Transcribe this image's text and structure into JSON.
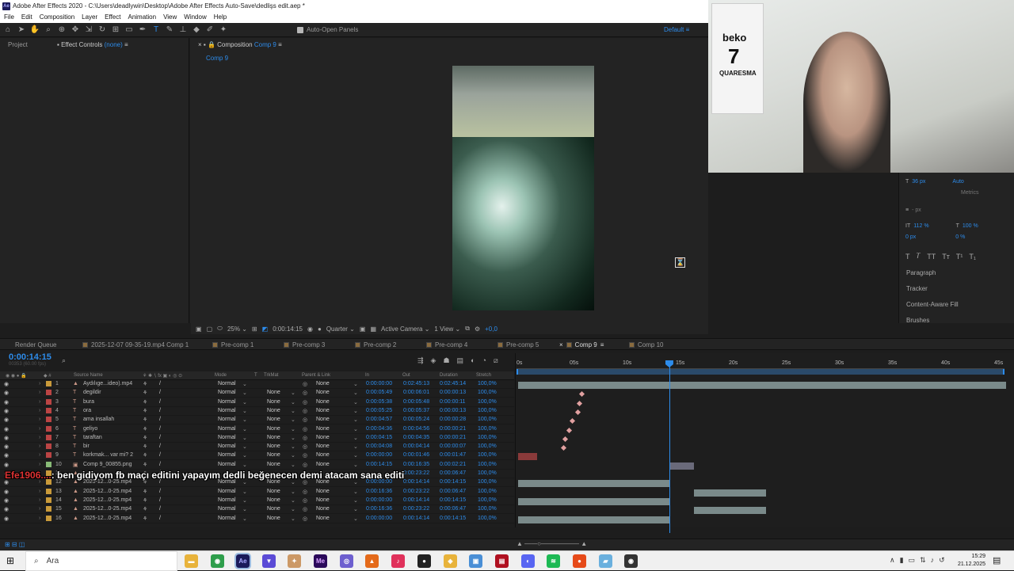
{
  "window": {
    "title": "Adobe After Effects 2020 - C:\\Users\\deadlywin\\Desktop\\Adobe After Effects Auto-Save\\dedlişs edit.aep *",
    "logo": "Ae"
  },
  "menu": [
    "File",
    "Edit",
    "Composition",
    "Layer",
    "Effect",
    "Animation",
    "View",
    "Window",
    "Help"
  ],
  "toolbar": {
    "auto_open": "Auto-Open Panels",
    "workspace": "Default"
  },
  "left_panel": {
    "tab_project": "Project",
    "tab_effect": "Effect Controls",
    "effect_target": "(none)"
  },
  "comp_panel": {
    "tab_label": "Composition",
    "tab_comp": "Comp 9",
    "breadcrumb": "Comp 9"
  },
  "viewer_footer": {
    "zoom": "25%",
    "time": "0:00:14:15",
    "resolution": "Quarter",
    "camera": "Active Camera",
    "view": "1 View",
    "exposure": "+0,0"
  },
  "webcam": {
    "shirt_brand": "beko",
    "shirt_number": "7",
    "shirt_name": "QUARESMA"
  },
  "character_panel": {
    "font_size": "36 px",
    "leading": "Auto",
    "kerning": "Metrics",
    "tracking": "0",
    "stroke": "- px",
    "vscale": "112 %",
    "hscale": "100 %",
    "baseline": "0 px",
    "tsume": "0 %"
  },
  "right_panels": [
    "Paragraph",
    "Tracker",
    "Content-Aware Fill",
    "Brushes"
  ],
  "comp_tabs": [
    {
      "label": "Render Queue"
    },
    {
      "label": "2025-12-07 09-35-19.mp4 Comp 1"
    },
    {
      "label": "Pre-comp 1"
    },
    {
      "label": "Pre-comp 3"
    },
    {
      "label": "Pre-comp 2"
    },
    {
      "label": "Pre-comp 4"
    },
    {
      "label": "Pre-comp 5"
    },
    {
      "label": "Comp 9"
    },
    {
      "label": "Comp 10"
    }
  ],
  "timeline": {
    "timecode": "0:00:14:15",
    "fps": "00353 (60.00 fps)",
    "headers": {
      "source": "Source Name",
      "mode": "Mode",
      "trkmat": "TrkMat",
      "parent": "Parent & Link",
      "in": "In",
      "out": "Out",
      "duration": "Duration",
      "stretch": "Stretch"
    },
    "ruler": [
      "0s",
      "05s",
      "10s",
      "15s",
      "20s",
      "25s",
      "30s",
      "35s",
      "40s",
      "45s"
    ],
    "layers": [
      {
        "num": "1",
        "name": "Aydılıge...ideo).mp4",
        "mode": "Normal",
        "trk": "",
        "parent": "None",
        "in": "0:00:00:00",
        "out": "0:02:45:13",
        "dur": "0:02:45:14",
        "str": "100,0%",
        "color": "#c99a3a",
        "type": "video"
      },
      {
        "num": "2",
        "name": "degildir",
        "mode": "Normal",
        "trk": "None",
        "parent": "None",
        "in": "0:00:05:49",
        "out": "0:00:06:01",
        "dur": "0:00:00:13",
        "str": "100,0%",
        "color": "#b44",
        "type": "text"
      },
      {
        "num": "3",
        "name": "bura",
        "mode": "Normal",
        "trk": "None",
        "parent": "None",
        "in": "0:00:05:38",
        "out": "0:00:05:48",
        "dur": "0:00:00:11",
        "str": "100,0%",
        "color": "#b44",
        "type": "text"
      },
      {
        "num": "4",
        "name": "ora",
        "mode": "Normal",
        "trk": "None",
        "parent": "None",
        "in": "0:00:05:25",
        "out": "0:00:05:37",
        "dur": "0:00:00:13",
        "str": "100,0%",
        "color": "#b44",
        "type": "text"
      },
      {
        "num": "5",
        "name": "ama insallah",
        "mode": "Normal",
        "trk": "None",
        "parent": "None",
        "in": "0:00:04:57",
        "out": "0:00:05:24",
        "dur": "0:00:00:28",
        "str": "100,0%",
        "color": "#b44",
        "type": "text"
      },
      {
        "num": "6",
        "name": "geliyo",
        "mode": "Normal",
        "trk": "None",
        "parent": "None",
        "in": "0:00:04:36",
        "out": "0:00:04:56",
        "dur": "0:00:00:21",
        "str": "100,0%",
        "color": "#b44",
        "type": "text"
      },
      {
        "num": "7",
        "name": "taraftan",
        "mode": "Normal",
        "trk": "None",
        "parent": "None",
        "in": "0:00:04:15",
        "out": "0:00:04:35",
        "dur": "0:00:00:21",
        "str": "100,0%",
        "color": "#b44",
        "type": "text"
      },
      {
        "num": "8",
        "name": "bir",
        "mode": "Normal",
        "trk": "None",
        "parent": "None",
        "in": "0:00:04:08",
        "out": "0:00:04:14",
        "dur": "0:00:00:07",
        "str": "100,0%",
        "color": "#b44",
        "type": "text"
      },
      {
        "num": "9",
        "name": "korkmak... var mi? 2",
        "mode": "Normal",
        "trk": "None",
        "parent": "None",
        "in": "0:00:00:00",
        "out": "0:00:01:46",
        "dur": "0:00:01:47",
        "str": "100,0%",
        "color": "#b44",
        "type": "text"
      },
      {
        "num": "10",
        "name": "Comp 9_00855.png",
        "mode": "Normal",
        "trk": "None",
        "parent": "None",
        "in": "0:00:14:15",
        "out": "0:00:16:35",
        "dur": "0:00:02:21",
        "str": "100,0%",
        "color": "#8b7",
        "type": "image"
      },
      {
        "num": "11",
        "name": "",
        "mode": "",
        "trk": "",
        "parent": "",
        "in": "",
        "out": "0:00:23:22",
        "dur": "0:00:06:47",
        "str": "100,0%",
        "color": "#c99a3a",
        "type": "video"
      },
      {
        "num": "12",
        "name": "2025-12...0-25.mp4",
        "mode": "Normal",
        "trk": "None",
        "parent": "None",
        "in": "0:00:00:00",
        "out": "0:00:14:14",
        "dur": "0:00:14:15",
        "str": "100,0%",
        "color": "#c99a3a",
        "type": "video"
      },
      {
        "num": "13",
        "name": "2025-12...0-25.mp4",
        "mode": "Normal",
        "trk": "None",
        "parent": "None",
        "in": "0:00:16:36",
        "out": "0:00:23:22",
        "dur": "0:00:06:47",
        "str": "100,0%",
        "color": "#c99a3a",
        "type": "video"
      },
      {
        "num": "14",
        "name": "2025-12...0-25.mp4",
        "mode": "Normal",
        "trk": "None",
        "parent": "None",
        "in": "0:00:00:00",
        "out": "0:00:14:14",
        "dur": "0:00:14:15",
        "str": "100,0%",
        "color": "#c99a3a",
        "type": "video"
      },
      {
        "num": "15",
        "name": "2025-12...0-25.mp4",
        "mode": "Normal",
        "trk": "None",
        "parent": "None",
        "in": "0:00:16:36",
        "out": "0:00:23:22",
        "dur": "0:00:06:47",
        "str": "100,0%",
        "color": "#c99a3a",
        "type": "video"
      },
      {
        "num": "16",
        "name": "2025-12...0-25.mp4",
        "mode": "Normal",
        "trk": "None",
        "parent": "None",
        "in": "0:00:00:00",
        "out": "0:00:14:14",
        "dur": "0:00:14:15",
        "str": "100,0%",
        "color": "#c99a3a",
        "type": "video"
      }
    ]
  },
  "stream_chat": {
    "user": "Efe1906....",
    "message": ": ben gidiyom fb maçı editini yapayım dedli beğenecen demi atacam sana editi"
  },
  "taskbar": {
    "search": "Ara",
    "time": "15:29",
    "date": "21.12.2025"
  },
  "colors": {
    "accent": "#2d8ceb",
    "bg": "#1d1d1d"
  }
}
